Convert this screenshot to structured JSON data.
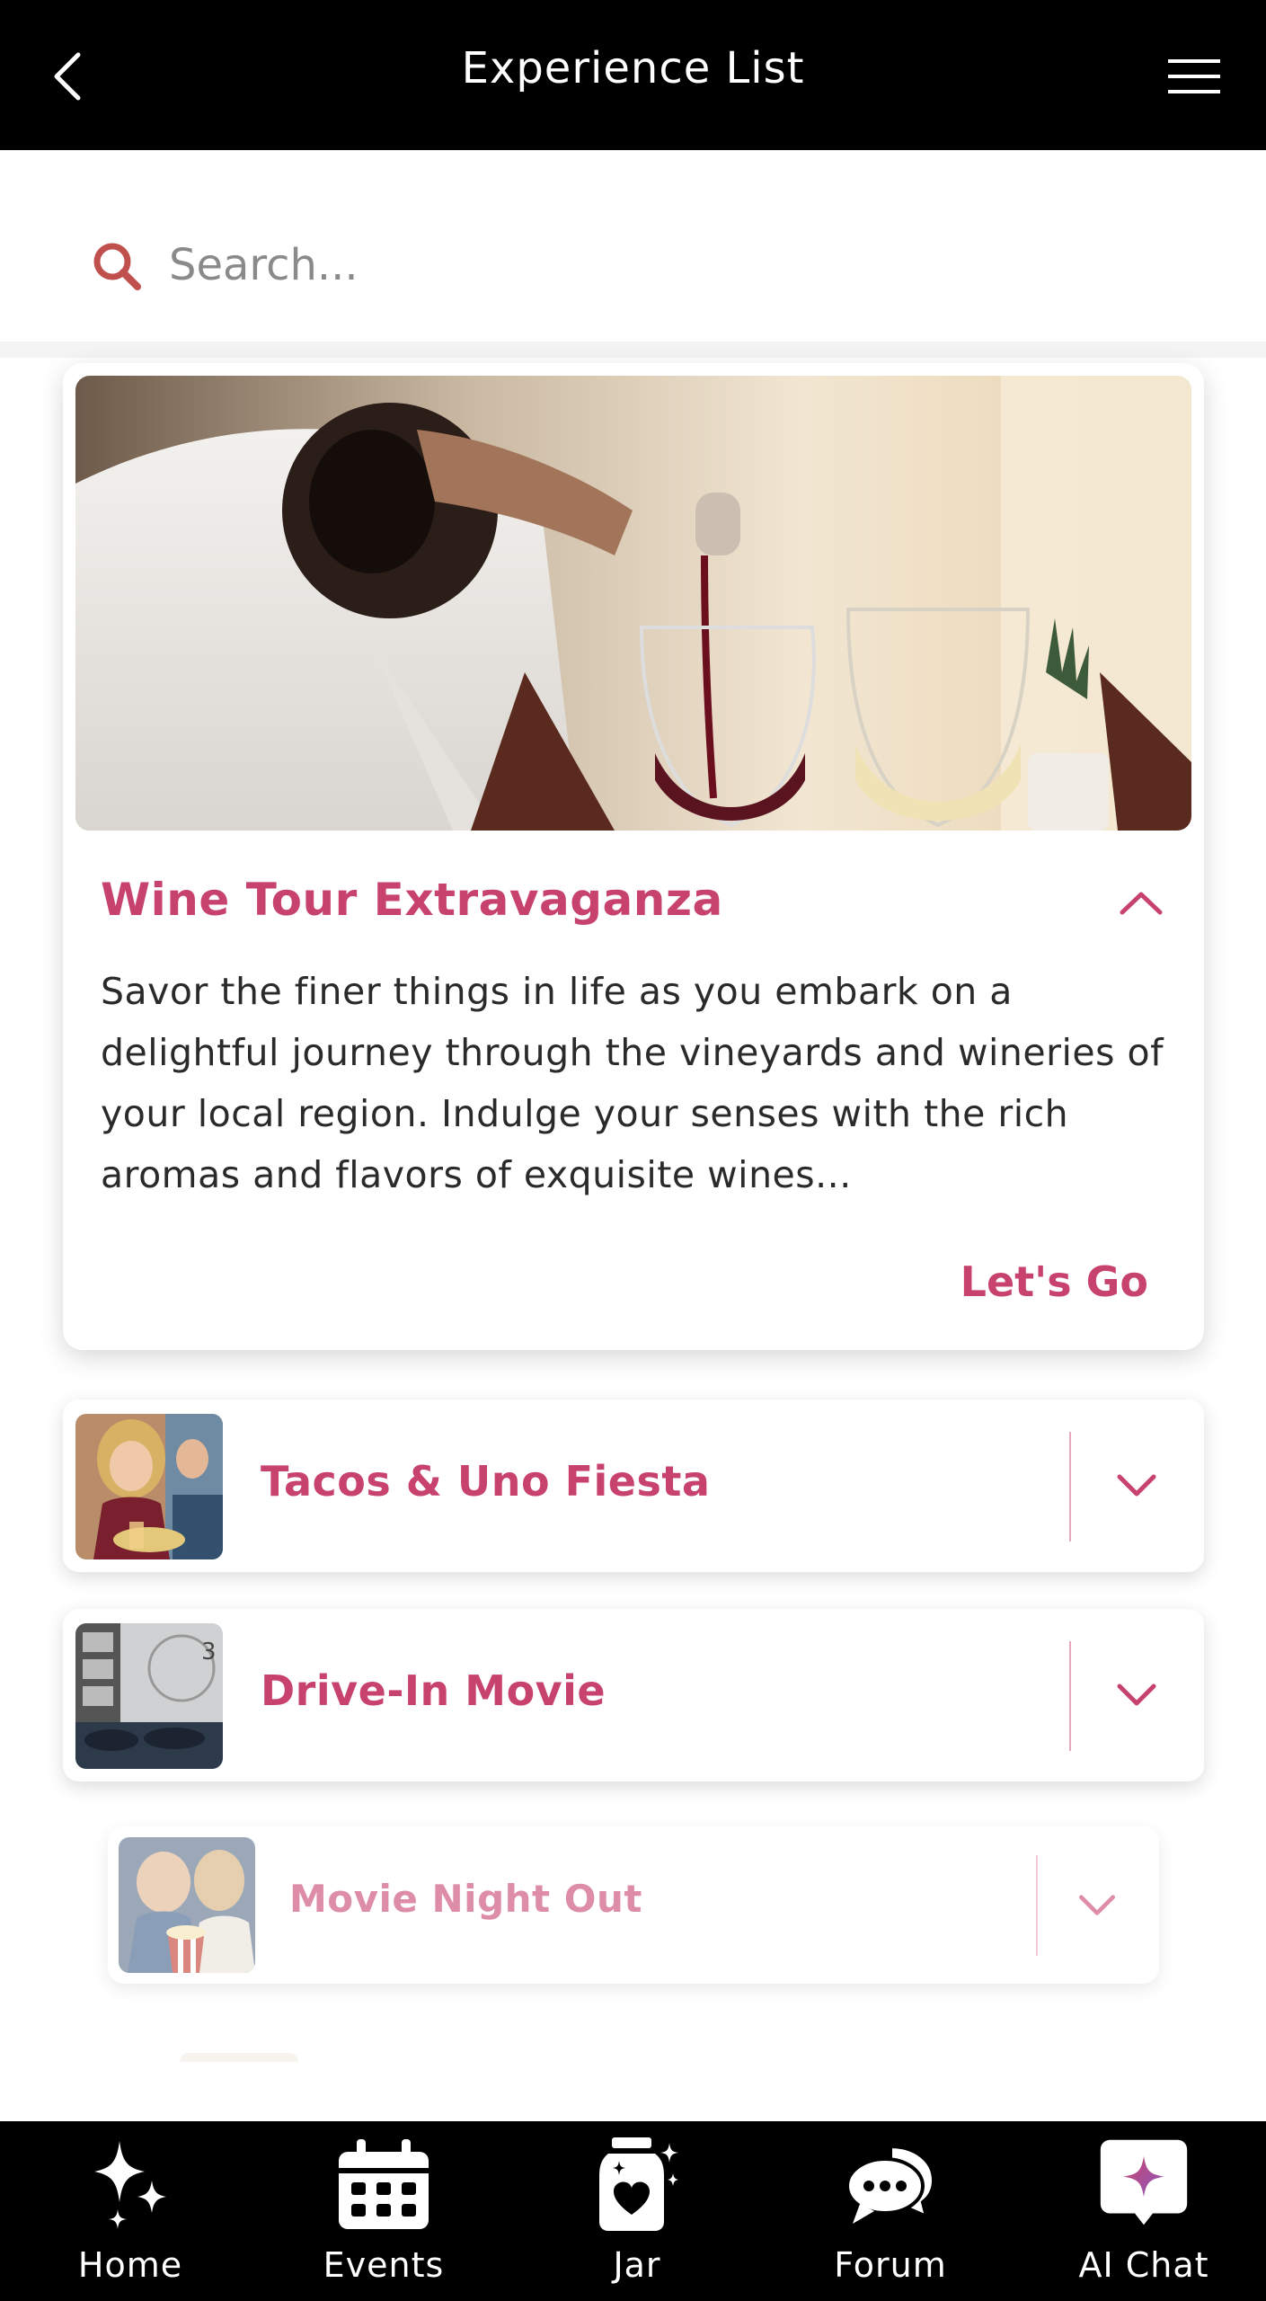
{
  "header": {
    "title": "Experience List",
    "back_icon": "chevron-left-icon",
    "menu_icon": "hamburger-menu-icon"
  },
  "search": {
    "placeholder": "Search...",
    "value": "",
    "icon": "search-icon"
  },
  "featured": {
    "title": "Wine Tour Extravaganza",
    "description": "Savor the finer things in life as you embark on a delightful journey through the vineyards and wineries of your local region. Indulge your senses with the rich aromas and flavors of exquisite wines...",
    "cta_label": "Let's Go",
    "expanded": true,
    "image": "wine-pouring-photo"
  },
  "experiences": [
    {
      "title": "Tacos & Uno Fiesta",
      "image": "friends-dining-photo",
      "expanded": false
    },
    {
      "title": "Drive-In Movie",
      "image": "drive-in-cinema-photo",
      "expanded": false
    },
    {
      "title": "Movie Night Out",
      "image": "couple-popcorn-photo",
      "expanded": false
    }
  ],
  "nav": {
    "items": [
      {
        "label": "Home",
        "icon": "sparkles-icon"
      },
      {
        "label": "Events",
        "icon": "calendar-icon"
      },
      {
        "label": "Jar",
        "icon": "heart-jar-icon"
      },
      {
        "label": "Forum",
        "icon": "chat-bubbles-icon"
      },
      {
        "label": "AI Chat",
        "icon": "ai-chat-icon"
      }
    ]
  },
  "colors": {
    "accent": "#c8426e",
    "header_bg": "#000000",
    "nav_bg": "#000000",
    "text": "#2a2a2a",
    "search_icon": "#c0504d"
  }
}
